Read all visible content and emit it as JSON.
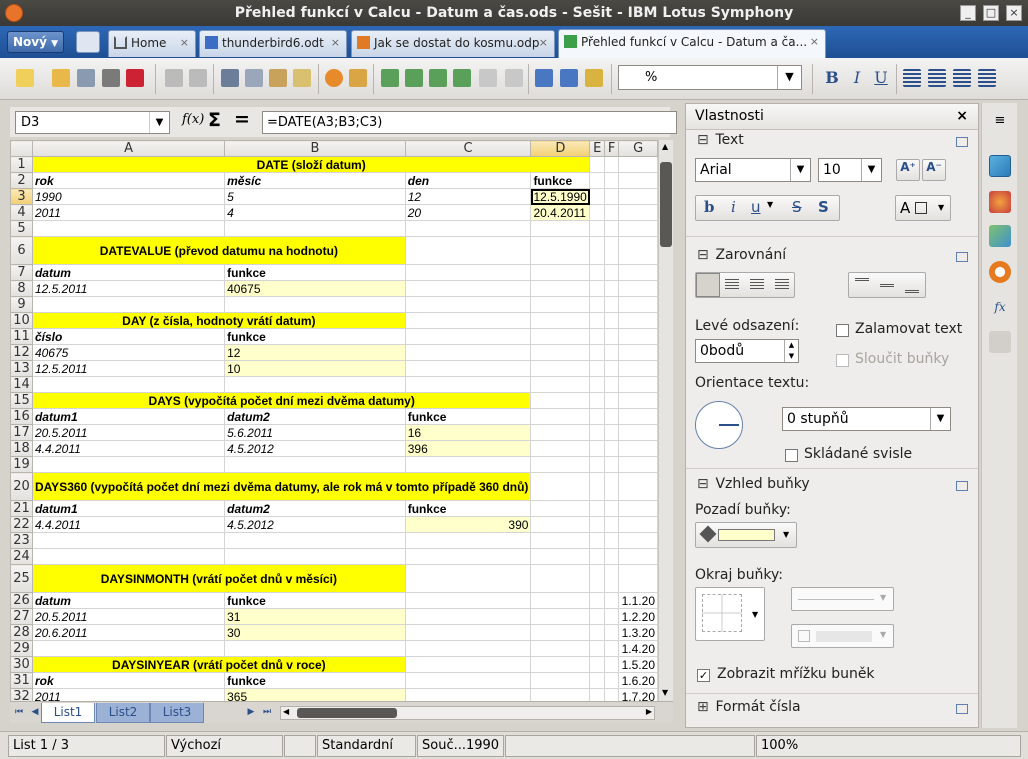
{
  "window": {
    "title": "Přehled funkcí v Calcu - Datum a čas.ods - Sešit - IBM Lotus Symphony",
    "controls": [
      "_",
      "□",
      "×"
    ]
  },
  "tabs": {
    "new_label": "Nový",
    "items": [
      {
        "label": "Home",
        "close": "×"
      },
      {
        "label": "thunderbird6.odt",
        "close": "×"
      },
      {
        "label": "Jak se dostat do kosmu.odp",
        "close": "×"
      },
      {
        "label": "Přehled funkcí v Calcu - Datum a ča...",
        "close": "×"
      }
    ]
  },
  "toolbar": {
    "style_value": "%",
    "format_buttons": [
      "B",
      "I",
      "U"
    ]
  },
  "formula_bar": {
    "cell_ref": "D3",
    "fx": "f(x)",
    "sum": "Σ",
    "equals": "=",
    "formula": "=DATE(A3;B3;C3)"
  },
  "sheet": {
    "columns": [
      "A",
      "B",
      "C",
      "D",
      "E",
      "F",
      "G"
    ],
    "rows": [
      {
        "n": "1",
        "cells": [
          {
            "v": "DATE (složí datum)",
            "span": 4,
            "c": "y hdr"
          },
          {
            "v": ""
          },
          {
            "v": ""
          },
          {
            "v": ""
          }
        ]
      },
      {
        "n": "2",
        "cells": [
          {
            "v": "rok",
            "c": "bi"
          },
          {
            "v": "měsíc",
            "c": "bi"
          },
          {
            "v": "den",
            "c": "bi"
          },
          {
            "v": "funkce",
            "c": "b"
          },
          {
            "v": ""
          },
          {
            "v": ""
          },
          {
            "v": ""
          }
        ]
      },
      {
        "n": "3",
        "cells": [
          {
            "v": "1990",
            "c": "i"
          },
          {
            "v": "5",
            "c": "i"
          },
          {
            "v": "12",
            "c": "i"
          },
          {
            "v": "12.5.1990",
            "c": "ly act"
          },
          {
            "v": ""
          },
          {
            "v": ""
          },
          {
            "v": ""
          }
        ]
      },
      {
        "n": "4",
        "cells": [
          {
            "v": "2011",
            "c": "i"
          },
          {
            "v": "4",
            "c": "i"
          },
          {
            "v": "20",
            "c": "i"
          },
          {
            "v": "20.4.2011",
            "c": "ly"
          },
          {
            "v": ""
          },
          {
            "v": ""
          },
          {
            "v": ""
          }
        ]
      },
      {
        "n": "5",
        "cells": [
          {
            "v": ""
          },
          {
            "v": ""
          },
          {
            "v": ""
          },
          {
            "v": ""
          },
          {
            "v": ""
          },
          {
            "v": ""
          },
          {
            "v": ""
          }
        ]
      },
      {
        "n": "6",
        "h": 28,
        "cells": [
          {
            "v": "DATEVALUE (převod datumu na hodnotu)",
            "span": 2,
            "c": "y hdr"
          },
          {
            "v": ""
          },
          {
            "v": ""
          },
          {
            "v": ""
          },
          {
            "v": ""
          },
          {
            "v": ""
          }
        ]
      },
      {
        "n": "7",
        "cells": [
          {
            "v": "datum",
            "c": "bi"
          },
          {
            "v": "funkce",
            "c": "b"
          },
          {
            "v": ""
          },
          {
            "v": ""
          },
          {
            "v": ""
          },
          {
            "v": ""
          },
          {
            "v": ""
          }
        ]
      },
      {
        "n": "8",
        "cells": [
          {
            "v": "12.5.2011",
            "c": "i"
          },
          {
            "v": "40675",
            "c": "ly"
          },
          {
            "v": ""
          },
          {
            "v": ""
          },
          {
            "v": ""
          },
          {
            "v": ""
          },
          {
            "v": ""
          }
        ]
      },
      {
        "n": "9",
        "cells": [
          {
            "v": ""
          },
          {
            "v": ""
          },
          {
            "v": ""
          },
          {
            "v": ""
          },
          {
            "v": ""
          },
          {
            "v": ""
          },
          {
            "v": ""
          }
        ]
      },
      {
        "n": "10",
        "cells": [
          {
            "v": "DAY (z čísla, hodnoty vrátí datum)",
            "span": 2,
            "c": "y hdr"
          },
          {
            "v": ""
          },
          {
            "v": ""
          },
          {
            "v": ""
          },
          {
            "v": ""
          },
          {
            "v": ""
          }
        ]
      },
      {
        "n": "11",
        "cells": [
          {
            "v": "číslo",
            "c": "bi"
          },
          {
            "v": "funkce",
            "c": "b"
          },
          {
            "v": ""
          },
          {
            "v": ""
          },
          {
            "v": ""
          },
          {
            "v": ""
          },
          {
            "v": ""
          }
        ]
      },
      {
        "n": "12",
        "cells": [
          {
            "v": "40675",
            "c": "i"
          },
          {
            "v": "12",
            "c": "ly"
          },
          {
            "v": ""
          },
          {
            "v": ""
          },
          {
            "v": ""
          },
          {
            "v": ""
          },
          {
            "v": ""
          }
        ]
      },
      {
        "n": "13",
        "cells": [
          {
            "v": "12.5.2011",
            "c": "i"
          },
          {
            "v": "10",
            "c": "ly"
          },
          {
            "v": ""
          },
          {
            "v": ""
          },
          {
            "v": ""
          },
          {
            "v": ""
          },
          {
            "v": ""
          }
        ]
      },
      {
        "n": "14",
        "cells": [
          {
            "v": ""
          },
          {
            "v": ""
          },
          {
            "v": ""
          },
          {
            "v": ""
          },
          {
            "v": ""
          },
          {
            "v": ""
          },
          {
            "v": ""
          }
        ]
      },
      {
        "n": "15",
        "cells": [
          {
            "v": "DAYS (vypočítá počet dní mezi dvěma datumy)",
            "span": 3,
            "c": "y hdr"
          },
          {
            "v": ""
          },
          {
            "v": ""
          },
          {
            "v": ""
          },
          {
            "v": ""
          }
        ]
      },
      {
        "n": "16",
        "cells": [
          {
            "v": "datum1",
            "c": "bi"
          },
          {
            "v": "datum2",
            "c": "bi"
          },
          {
            "v": "funkce",
            "c": "b"
          },
          {
            "v": ""
          },
          {
            "v": ""
          },
          {
            "v": ""
          },
          {
            "v": ""
          }
        ]
      },
      {
        "n": "17",
        "cells": [
          {
            "v": "20.5.2011",
            "c": "i"
          },
          {
            "v": "5.6.2011",
            "c": "i"
          },
          {
            "v": "16",
            "c": "ly"
          },
          {
            "v": ""
          },
          {
            "v": ""
          },
          {
            "v": ""
          },
          {
            "v": ""
          }
        ]
      },
      {
        "n": "18",
        "cells": [
          {
            "v": "4.4.2011",
            "c": "i"
          },
          {
            "v": "4.5.2012",
            "c": "i"
          },
          {
            "v": "396",
            "c": "ly"
          },
          {
            "v": ""
          },
          {
            "v": ""
          },
          {
            "v": ""
          },
          {
            "v": ""
          }
        ]
      },
      {
        "n": "19",
        "cells": [
          {
            "v": ""
          },
          {
            "v": ""
          },
          {
            "v": ""
          },
          {
            "v": ""
          },
          {
            "v": ""
          },
          {
            "v": ""
          },
          {
            "v": ""
          }
        ]
      },
      {
        "n": "20",
        "h": 28,
        "cells": [
          {
            "v": "DAYS360 (vypočítá počet dní mezi dvěma datumy, ale rok má v tomto případě 360 dnů)",
            "span": 3,
            "c": "y hdr"
          },
          {
            "v": ""
          },
          {
            "v": ""
          },
          {
            "v": ""
          },
          {
            "v": ""
          }
        ]
      },
      {
        "n": "21",
        "cells": [
          {
            "v": "datum1",
            "c": "bi"
          },
          {
            "v": "datum2",
            "c": "bi"
          },
          {
            "v": "funkce",
            "c": "b"
          },
          {
            "v": ""
          },
          {
            "v": ""
          },
          {
            "v": ""
          },
          {
            "v": ""
          }
        ]
      },
      {
        "n": "22",
        "cells": [
          {
            "v": "4.4.2011",
            "c": "i"
          },
          {
            "v": "4.5.2012",
            "c": "i"
          },
          {
            "v": "390",
            "c": "ly r"
          },
          {
            "v": ""
          },
          {
            "v": ""
          },
          {
            "v": ""
          },
          {
            "v": ""
          }
        ]
      },
      {
        "n": "23",
        "cells": [
          {
            "v": ""
          },
          {
            "v": ""
          },
          {
            "v": ""
          },
          {
            "v": ""
          },
          {
            "v": ""
          },
          {
            "v": ""
          },
          {
            "v": ""
          }
        ]
      },
      {
        "n": "24",
        "cells": [
          {
            "v": ""
          },
          {
            "v": ""
          },
          {
            "v": ""
          },
          {
            "v": ""
          },
          {
            "v": ""
          },
          {
            "v": ""
          },
          {
            "v": ""
          }
        ]
      },
      {
        "n": "25",
        "h": 28,
        "cells": [
          {
            "v": "DAYSINMONTH (vrátí počet dnů v měsíci)",
            "span": 2,
            "c": "y hdr"
          },
          {
            "v": ""
          },
          {
            "v": ""
          },
          {
            "v": ""
          },
          {
            "v": ""
          },
          {
            "v": ""
          }
        ]
      },
      {
        "n": "26",
        "cells": [
          {
            "v": "datum",
            "c": "bi"
          },
          {
            "v": "funkce",
            "c": "b"
          },
          {
            "v": ""
          },
          {
            "v": ""
          },
          {
            "v": ""
          },
          {
            "v": ""
          },
          {
            "v": "1.1.20",
            "c": "r"
          }
        ]
      },
      {
        "n": "27",
        "cells": [
          {
            "v": "20.5.2011",
            "c": "i"
          },
          {
            "v": "31",
            "c": "ly"
          },
          {
            "v": ""
          },
          {
            "v": ""
          },
          {
            "v": ""
          },
          {
            "v": ""
          },
          {
            "v": "1.2.20",
            "c": "r"
          }
        ]
      },
      {
        "n": "28",
        "cells": [
          {
            "v": "20.6.2011",
            "c": "i"
          },
          {
            "v": "30",
            "c": "ly"
          },
          {
            "v": ""
          },
          {
            "v": ""
          },
          {
            "v": ""
          },
          {
            "v": ""
          },
          {
            "v": "1.3.20",
            "c": "r"
          }
        ]
      },
      {
        "n": "29",
        "cells": [
          {
            "v": ""
          },
          {
            "v": ""
          },
          {
            "v": ""
          },
          {
            "v": ""
          },
          {
            "v": ""
          },
          {
            "v": ""
          },
          {
            "v": "1.4.20",
            "c": "r"
          }
        ]
      },
      {
        "n": "30",
        "cells": [
          {
            "v": "DAYSINYEAR (vrátí počet dnů v roce)",
            "span": 2,
            "c": "y hdr"
          },
          {
            "v": ""
          },
          {
            "v": ""
          },
          {
            "v": ""
          },
          {
            "v": ""
          },
          {
            "v": "1.5.20",
            "c": "r"
          }
        ]
      },
      {
        "n": "31",
        "cells": [
          {
            "v": "rok",
            "c": "bi"
          },
          {
            "v": "funkce",
            "c": "b"
          },
          {
            "v": ""
          },
          {
            "v": ""
          },
          {
            "v": ""
          },
          {
            "v": ""
          },
          {
            "v": "1.6.20",
            "c": "r"
          }
        ]
      },
      {
        "n": "32",
        "cells": [
          {
            "v": "2011",
            "c": "i"
          },
          {
            "v": "365",
            "c": "ly"
          },
          {
            "v": ""
          },
          {
            "v": ""
          },
          {
            "v": ""
          },
          {
            "v": ""
          },
          {
            "v": "1.7.20",
            "c": "r"
          }
        ]
      }
    ]
  },
  "sheet_tabs": [
    "List1",
    "List2",
    "List3"
  ],
  "status": {
    "sheet": "List 1 / 3",
    "style": "Výchozí",
    "mode": "Standardní",
    "sum": "Souč...1990",
    "zoom": "100%"
  },
  "panel": {
    "title": "Vlastnosti",
    "close": "×",
    "text_section": {
      "title": "Text",
      "font": "Arial",
      "size": "10"
    },
    "align_section": {
      "title": "Zarovnání",
      "indent_label": "Levé odsazení:",
      "indent_value": "0bodů",
      "wrap_label": "Zalamovat text",
      "merge_label": "Sloučit buňky",
      "orient_label": "Orientace textu:",
      "orient_value": "0 stupňů",
      "stack_label": "Skládané svisle"
    },
    "cell_section": {
      "title": "Vzhled buňky",
      "bg_label": "Pozadí buňky:",
      "bg_color": "#ffffcc",
      "border_label": "Okraj buňky:",
      "grid_label": "Zobrazit mřížku buněk",
      "grid_checked": "✓"
    },
    "number_section": {
      "title": "Formát čísla"
    }
  }
}
